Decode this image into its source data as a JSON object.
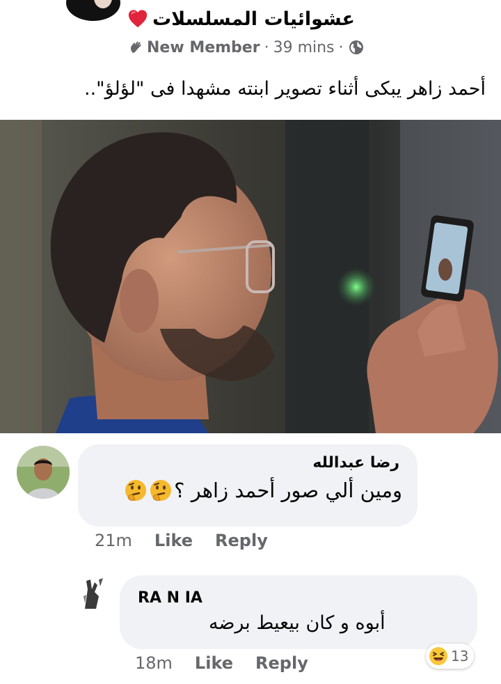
{
  "post": {
    "group_name": "عشوائيات المسلسلات",
    "badge": "New Member",
    "separator": "·",
    "time": "39 mins",
    "caption": "أحمد زاهر يبكى أثناء تصوير ابنته مشهدا فى \"لؤلؤ\"..",
    "icons": {
      "heart": "heart-icon",
      "wave": "wave-icon",
      "globe": "globe-icon"
    }
  },
  "comments": [
    {
      "author": "رضا عبدالله",
      "text": "ومين ألي صور أحمد زاهر ؟",
      "emoji": "thinking-face-icon",
      "time": "21m",
      "like_label": "Like",
      "reply_label": "Reply"
    },
    {
      "author": "RA N IA",
      "text": "أبوه و كان بيعيط برضه",
      "time": "18m",
      "like_label": "Like",
      "reply_label": "Reply",
      "reaction_icon": "laughing-face-icon",
      "reaction_count": "13"
    }
  ],
  "colors": {
    "text_primary": "#050505",
    "text_secondary": "#65676b",
    "bubble_bg": "#f0f2f5",
    "heart_red": "#e0243b"
  }
}
